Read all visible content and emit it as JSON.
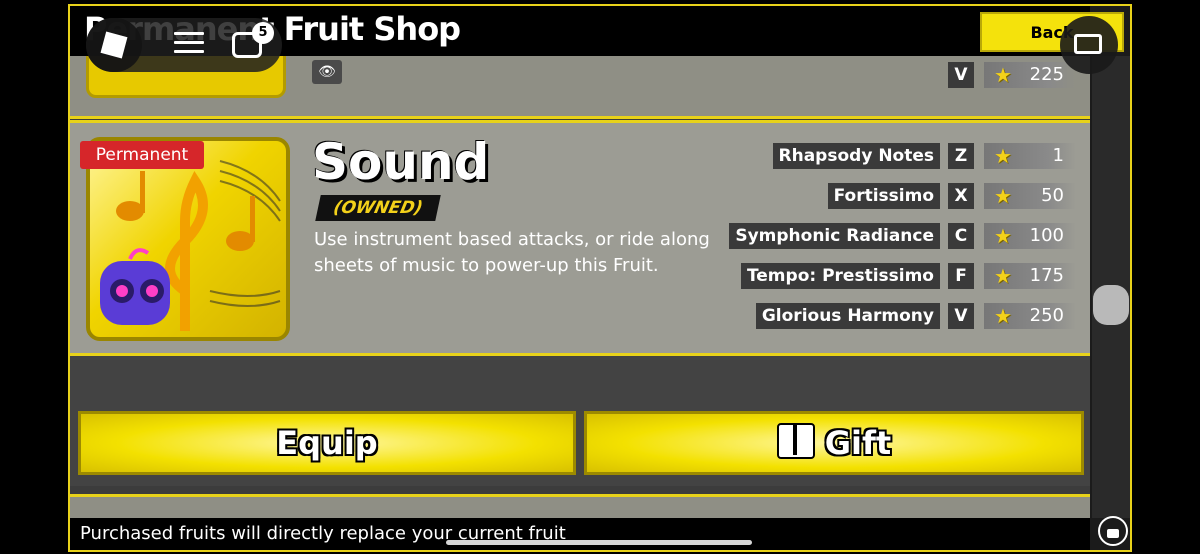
{
  "window": {
    "title": "Permanent Fruit Shop",
    "back_label": "Back"
  },
  "roblox": {
    "chat_count": "5"
  },
  "previous_row": {
    "key": "V",
    "cost": "225"
  },
  "fruit": {
    "badge": "Permanent",
    "name": "Sound",
    "status": "(OWNED)",
    "description": "Use instrument based attacks, or ride along sheets of music to power-up this Fruit.",
    "moves": [
      {
        "name": "Rhapsody Notes",
        "key": "Z",
        "cost": "1"
      },
      {
        "name": "Fortissimo",
        "key": "X",
        "cost": "50"
      },
      {
        "name": "Symphonic Radiance",
        "key": "C",
        "cost": "100"
      },
      {
        "name": "Tempo: Prestissimo",
        "key": "F",
        "cost": "175"
      },
      {
        "name": "Glorious Harmony",
        "key": "V",
        "cost": "250"
      }
    ]
  },
  "actions": {
    "equip_label": "Equip",
    "gift_label": "Gift"
  },
  "footer": {
    "text": "Purchased fruits will directly replace your current fruit"
  },
  "colors": {
    "accent": "#f4e20c",
    "badge": "#d6262a",
    "owned": "#f3d11a"
  }
}
